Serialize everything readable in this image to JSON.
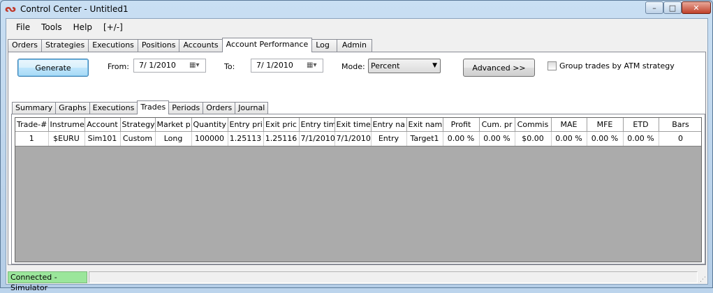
{
  "window": {
    "title": "Control Center - Untitled1",
    "icon": "ninja-logo-icon",
    "minimize_label": "–",
    "maximize_label": "□",
    "close_label": "✕"
  },
  "menu": [
    "File",
    "Tools",
    "Help",
    "[+/-]"
  ],
  "top_tabs": [
    "Orders",
    "Strategies",
    "Executions",
    "Positions",
    "Accounts",
    "Account Performance",
    "Log",
    "Admin"
  ],
  "top_tabs_active": "Account Performance",
  "controls": {
    "generate_label": "Generate",
    "from_label": "From:",
    "from_value": "7/  1/2010",
    "to_label": "To:",
    "to_value": "7/  1/2010",
    "mode_label": "Mode:",
    "mode_value": "Percent",
    "advanced_label": "Advanced >>",
    "group_trades_label": "Group trades by ATM strategy",
    "group_trades_checked": false
  },
  "inner_tabs": [
    "Summary",
    "Graphs",
    "Executions",
    "Trades",
    "Periods",
    "Orders",
    "Journal"
  ],
  "inner_tabs_active": "Trades",
  "trades_table": {
    "columns": [
      "Trade-#",
      "Instrume",
      "Account",
      "Strategy",
      "Market p",
      "Quantity",
      "Entry pri",
      "Exit pric",
      "Entry tim",
      "Exit time",
      "Entry na",
      "Exit nam",
      "Profit",
      "Cum. pr",
      "Commis",
      "MAE",
      "MFE",
      "ETD",
      "Bars"
    ],
    "rows": [
      [
        "1",
        "$EURU",
        "Sim101",
        "Custom",
        "Long",
        "100000",
        "1.25113",
        "1.25116",
        "7/1/2010",
        "7/1/2010",
        "Entry",
        "Target1",
        "0.00 %",
        "0.00 %",
        "$0.00",
        "0.00 %",
        "0.00 %",
        "0.00 %",
        "0"
      ]
    ]
  },
  "status": {
    "connection": "Connected - Simulator",
    "connection_color": "#9be69b"
  }
}
